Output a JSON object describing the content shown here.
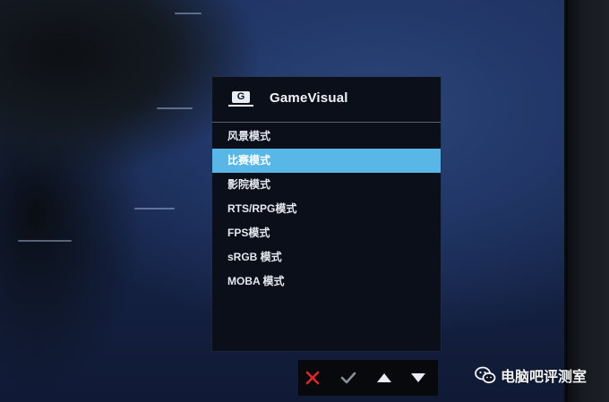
{
  "osd": {
    "title": "GameVisual",
    "icon_glyph": "G",
    "icon": "gamevisual-icon",
    "selected_index": 1,
    "selection_color": "#58b7e6",
    "items": [
      {
        "label": "风景模式"
      },
      {
        "label": "比赛模式"
      },
      {
        "label": "影院模式"
      },
      {
        "label": "RTS/RPG模式"
      },
      {
        "label": "FPS模式"
      },
      {
        "label": "sRGB 模式"
      },
      {
        "label": "MOBA 模式"
      }
    ]
  },
  "nav_buttons": [
    {
      "icon": "close-icon",
      "color": "#e0272d"
    },
    {
      "icon": "check-icon",
      "color": "#8a8f98"
    },
    {
      "icon": "arrow-up-icon",
      "color": "#e9ecf2"
    },
    {
      "icon": "arrow-down-icon",
      "color": "#e9ecf2"
    }
  ],
  "watermark": {
    "icon": "wechat-icon",
    "text": "电脑吧评测室"
  }
}
